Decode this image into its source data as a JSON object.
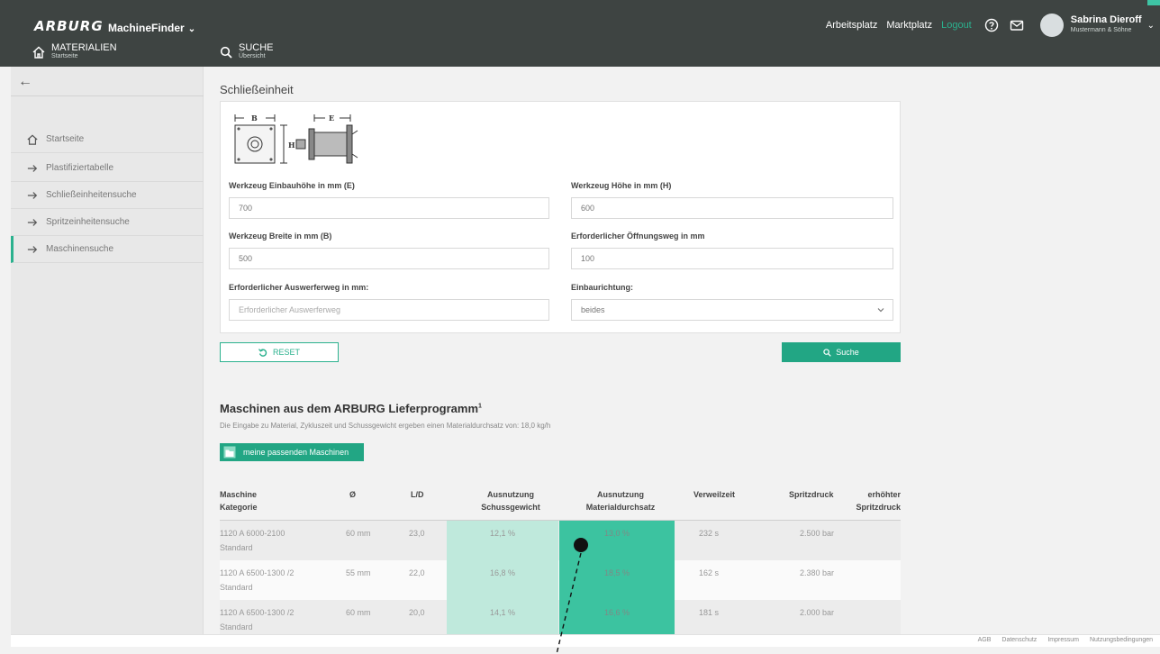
{
  "header": {
    "logo": "ARBURG",
    "app_switcher": "MachineFinder",
    "nav_materials": {
      "title": "MATERIALIEN",
      "sub": "Startseite"
    },
    "nav_search": {
      "title": "SUCHE",
      "sub": "Übersicht"
    },
    "links": [
      "Arbeitsplatz",
      "Marktplatz"
    ],
    "logout": "Logout",
    "user_name": "Sabrina Dieroff",
    "user_company": "Mustermann & Söhne"
  },
  "sidebar": {
    "items": [
      {
        "label": "Startseite",
        "icon": "home-icon"
      },
      {
        "label": "Plastifiziertabelle",
        "icon": "arrow-right-icon"
      },
      {
        "label": "Schließeinheitensuche",
        "icon": "arrow-right-icon"
      },
      {
        "label": "Spritzeinheitensuche",
        "icon": "arrow-right-icon"
      },
      {
        "label": "Maschinensuche",
        "icon": "arrow-right-icon"
      }
    ]
  },
  "form": {
    "title": "Schließeinheit",
    "diagram_labels": {
      "b": "B",
      "e": "E",
      "h": "H"
    },
    "fields": {
      "einbauhoehe_label": "Werkzeug Einbauhöhe in mm (E)",
      "einbauhoehe_value": "700",
      "hoehe_label": "Werkzeug Höhe in mm (H)",
      "hoehe_value": "600",
      "breite_label": "Werkzeug Breite in mm (B)",
      "breite_value": "500",
      "oeffnungsweg_label": "Erforderlicher Öffnungsweg in mm",
      "oeffnungsweg_value": "100",
      "auswerferweg_label": "Erforderlicher Auswerferweg in mm:",
      "auswerferweg_placeholder": "Erforderlicher Auswerferweg",
      "einbaurichtung_label": "Einbaurichtung:",
      "einbaurichtung_value": "beides"
    },
    "reset_label": "RESET",
    "search_label": "Suche"
  },
  "results": {
    "title": "Maschinen aus dem ARBURG Lieferprogramm",
    "title_sup": "1",
    "description": "Die Eingabe zu Material, Zykluszeit und Schussgewicht ergeben einen Materialdurchsatz von: 18,0 kg/h",
    "fav_button": "meine passenden Maschinen",
    "columns": {
      "maschine": "Maschine",
      "kategorie": "Kategorie",
      "durchmesser": "Ø",
      "ld": "L/D",
      "ausn_schuss_1": "Ausnutzung",
      "ausn_schuss_2": "Schussgewicht",
      "ausn_mat_1": "Ausnutzung",
      "ausn_mat_2": "Materialdurchsatz",
      "verweilzeit": "Verweilzeit",
      "spritzdruck": "Spritzdruck",
      "erhoeht_1": "erhöhter",
      "erhoeht_2": "Spritzdruck"
    },
    "rows": [
      {
        "maschine": "1120 A 6000-2100",
        "kategorie": "Standard",
        "durchmesser": "60 mm",
        "ld": "23,0",
        "schuss": "12,1 %",
        "material": "13,0 %",
        "verweilzeit": "232 s",
        "spritzdruck": "2.500 bar"
      },
      {
        "maschine": "1120 A 6500-1300 /2",
        "kategorie": "Standard",
        "durchmesser": "55 mm",
        "ld": "22,0",
        "schuss": "16,8 %",
        "material": "18,5 %",
        "verweilzeit": "162 s",
        "spritzdruck": "2.380 bar"
      },
      {
        "maschine": "1120 A 6500-1300 /2",
        "kategorie": "Standard",
        "durchmesser": "60 mm",
        "ld": "20,0",
        "schuss": "14,1 %",
        "material": "16,6 %",
        "verweilzeit": "181 s",
        "spritzdruck": "2.000 bar"
      }
    ]
  },
  "footer": {
    "links": [
      "AGB",
      "Datenschutz",
      "Impressum",
      "Nutzungsbedingungen"
    ]
  },
  "colors": {
    "accent": "#2bb18e",
    "header_bg": "#3e4442",
    "schuss_cell": "#bfe9dc",
    "material_cell": "#3cc3a0"
  }
}
